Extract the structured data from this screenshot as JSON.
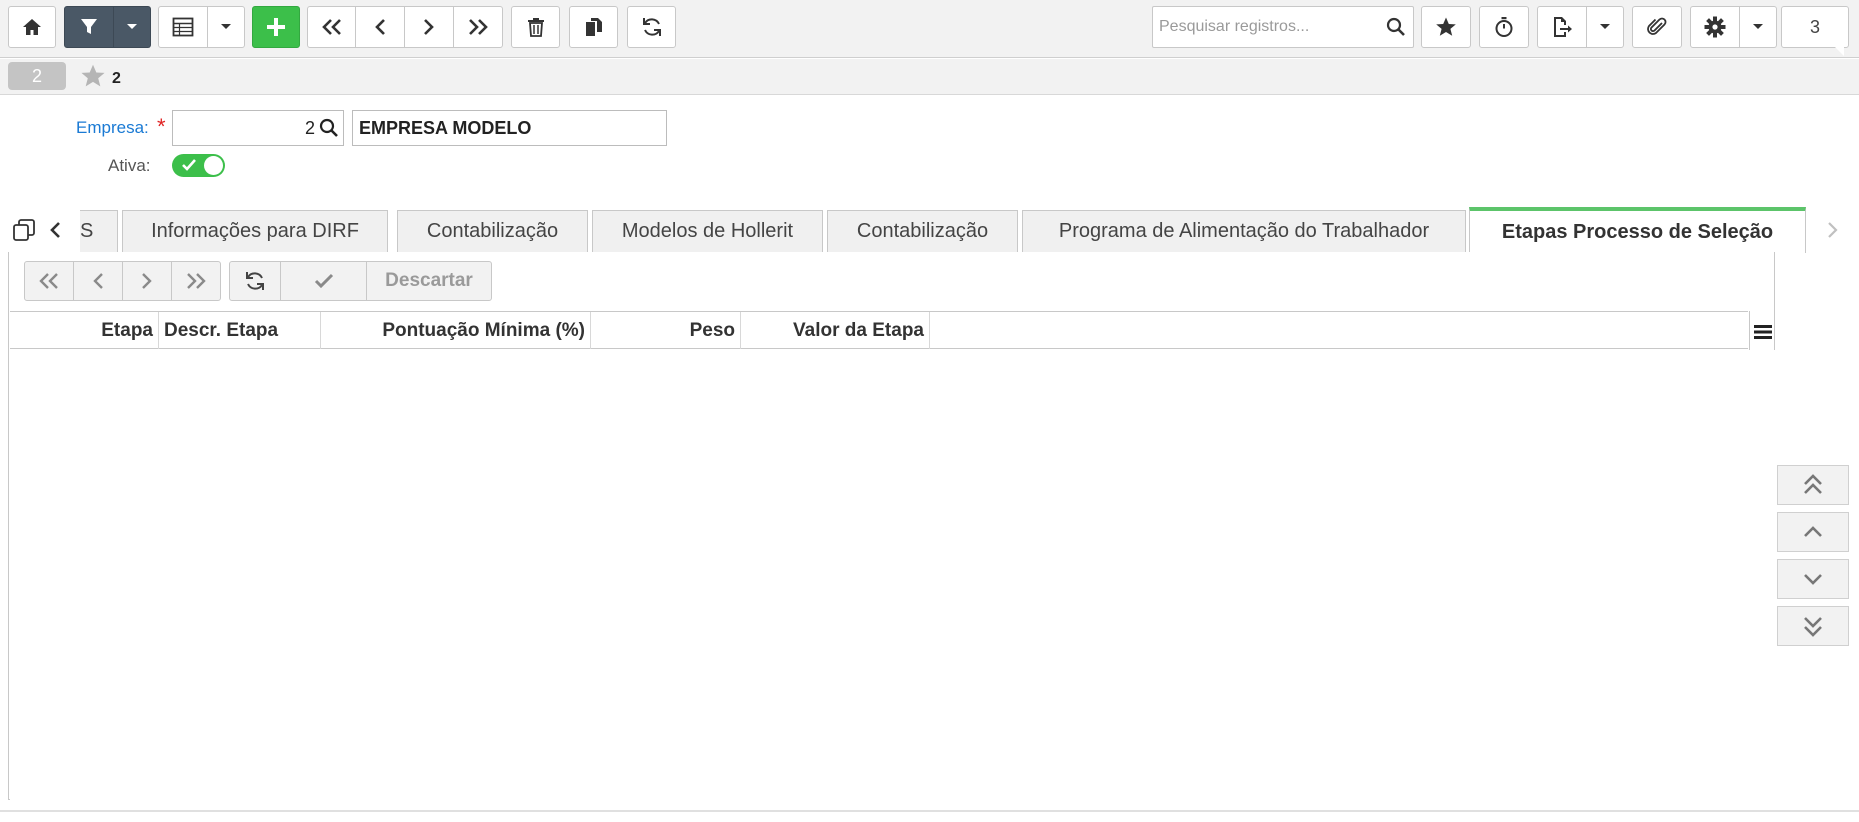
{
  "toolbar": {
    "search_placeholder": "Pesquisar registros...",
    "record_count": "3"
  },
  "record_strip": {
    "record_number": "2",
    "favorite_label": "2"
  },
  "form": {
    "empresa_label": "Empresa:",
    "required_mark": "*",
    "empresa_code": "2",
    "empresa_name": "EMPRESA MODELO",
    "ativa_label": "Ativa:",
    "ativa_value": true
  },
  "tabs": [
    {
      "label": "S",
      "active": false
    },
    {
      "label": "Informações para DIRF",
      "active": false
    },
    {
      "label": "Contabilização",
      "active": false
    },
    {
      "label": "Modelos de Hollerit",
      "active": false
    },
    {
      "label": "Contabilização",
      "active": false
    },
    {
      "label": "Programa de Alimentação do Trabalhador",
      "active": false
    },
    {
      "label": "Etapas Processo de Seleção",
      "active": true
    }
  ],
  "sub_toolbar": {
    "discard_label": "Descartar"
  },
  "grid": {
    "columns": [
      "Etapa",
      "Descr. Etapa",
      "Pontuação Mínima (%)",
      "Peso",
      "Valor da Etapa"
    ],
    "rows": []
  },
  "colors": {
    "accent_green": "#3cbf4a",
    "active_tab_border": "#5cc46a",
    "label_blue": "#1a7ad4",
    "required_red": "#e02424",
    "dark_button": "#4a5866"
  }
}
